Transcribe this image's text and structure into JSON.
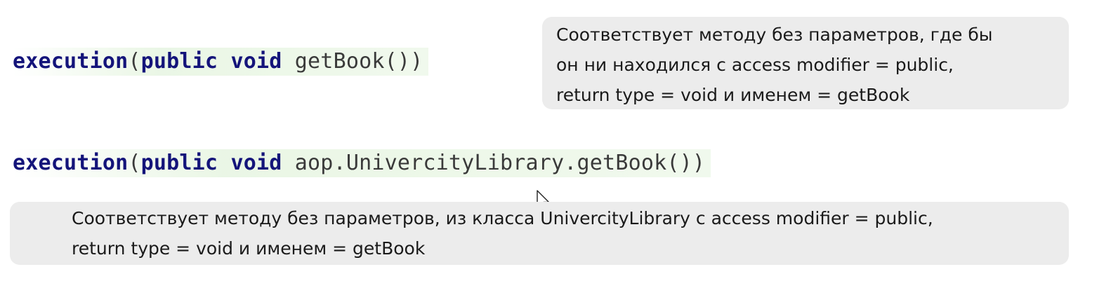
{
  "example1": {
    "code": {
      "keyword": "execution",
      "open_paren": "(",
      "modifier": "public",
      "return_type": "void",
      "method": "getBook()",
      "close_paren": ")"
    },
    "description": [
      "Соответствует методу без параметров, где бы",
      "он ни находился с access modifier = public,",
      "return type = void и именем = getBook"
    ]
  },
  "example2": {
    "code": {
      "keyword": "execution",
      "open_paren": "(",
      "modifier": "public",
      "return_type": "void",
      "method": "aop.UnivercityLibrary.getBook()",
      "close_paren": ")"
    },
    "description": [
      "Соответствует методу без параметров, из класса UnivercityLibrary с access modifier = public,",
      "return type = void и именем = getBook"
    ]
  },
  "colors": {
    "keyword": "#14147a",
    "plain_code": "#3a3a3a",
    "box_background": "#ececec",
    "code_highlight": "#e9f6e4"
  },
  "icons": {
    "cursor": "mouse-pointer-icon"
  }
}
